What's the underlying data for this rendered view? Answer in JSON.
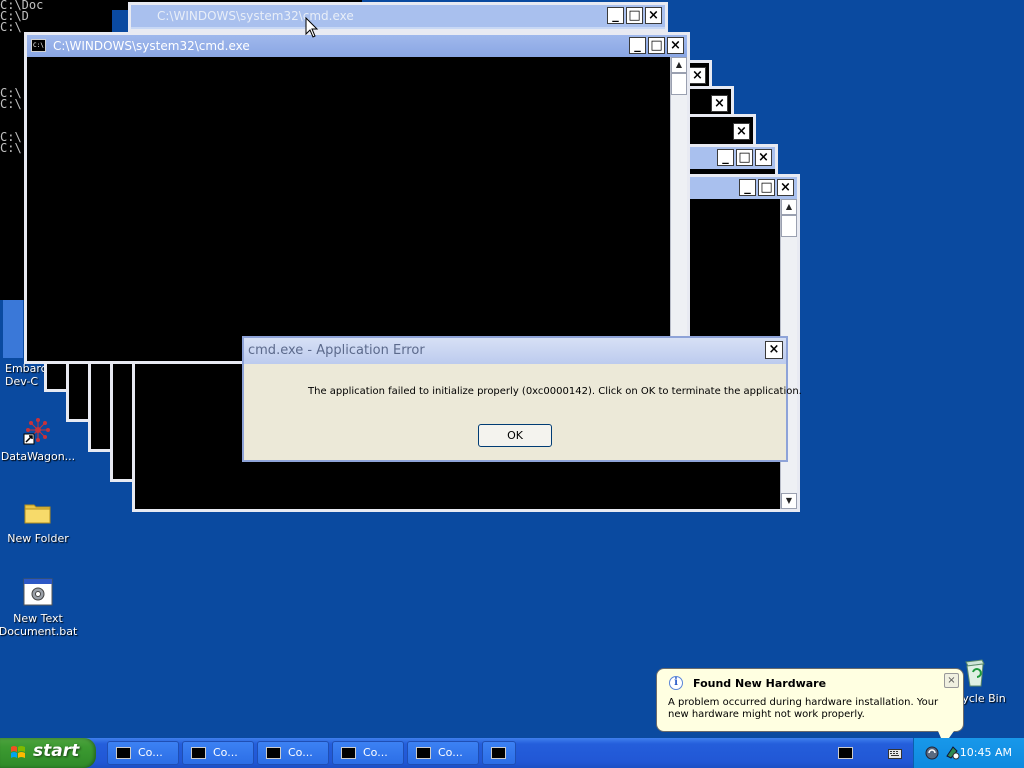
{
  "desktop": {
    "icons": [
      {
        "label": "Embarc\nDev-C",
        "icon": "embarcadero-icon"
      },
      {
        "label": "DataWagon...",
        "icon": "datawagon-shortcut-icon"
      },
      {
        "label": "New Folder",
        "icon": "folder-icon"
      },
      {
        "label": "New Text\nDocument.bat",
        "icon": "batch-file-icon"
      },
      {
        "label": "Recycle Bin",
        "icon": "recycle-bin-icon"
      }
    ]
  },
  "background_console": {
    "lines": "C:\\Doc\nC:\\D\nC:\\\n\n\n\n\n\nC:\\\nC:\\\n\n\nC:\\\nC:\\"
  },
  "windows": {
    "back_title": "C:\\WINDOWS\\system32\\cmd.exe",
    "front_title": "C:\\WINDOWS\\system32\\cmd.exe",
    "minimize": "_",
    "maximize": "□",
    "close": "×"
  },
  "dialog": {
    "title": "cmd.exe - Application Error",
    "message": "The application failed to initialize properly (0xc0000142). Click on OK to terminate the application.",
    "ok_label": "OK",
    "close": "×"
  },
  "balloon": {
    "title": "Found New Hardware",
    "text": "A problem occurred during hardware installation. Your new hardware might not work properly.",
    "close": "×",
    "info": "i"
  },
  "taskbar": {
    "start_label": "start",
    "buttons": [
      "Co...",
      "Co...",
      "Co...",
      "Co...",
      "Co...",
      ""
    ],
    "clock": "10:45 AM"
  },
  "colors": {
    "desktop": "#0a4aa0",
    "taskbar": "#245edb",
    "start": "#3c9a31",
    "tray": "#0f8adf",
    "dialog": "#ece9d8",
    "balloon": "#ffffe1"
  }
}
